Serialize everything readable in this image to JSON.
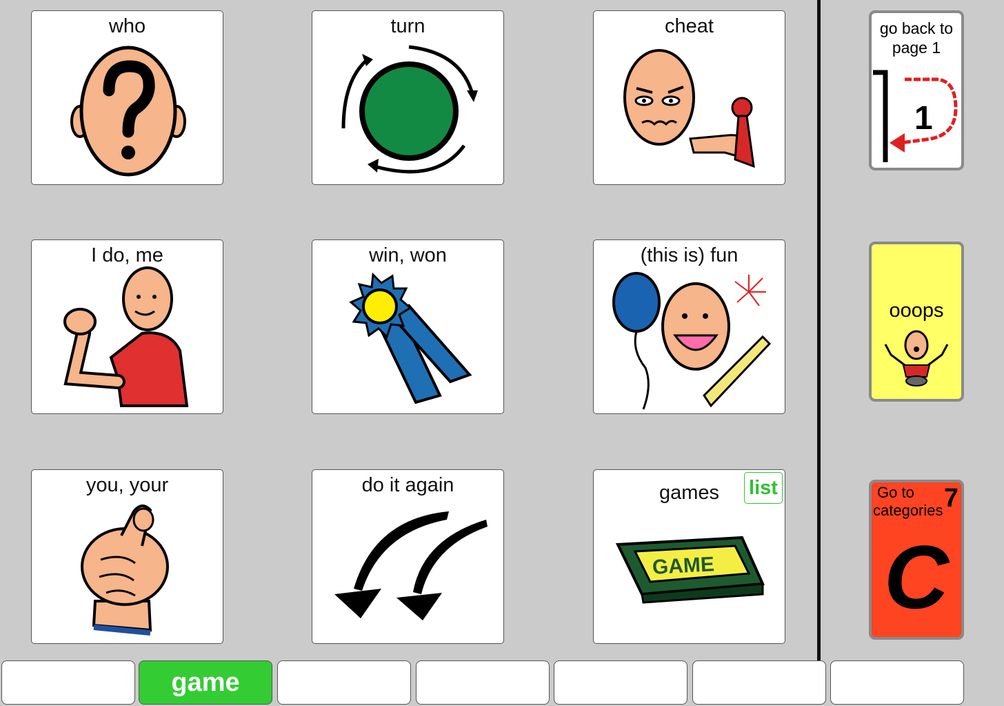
{
  "grid": {
    "tiles": [
      {
        "label": "who",
        "icon": "question-head-icon"
      },
      {
        "label": "turn",
        "icon": "turn-cycle-icon"
      },
      {
        "label": "cheat",
        "icon": "cheat-face-icon"
      },
      {
        "label": "I do, me",
        "icon": "point-self-icon"
      },
      {
        "label": "win,  won",
        "icon": "ribbon-icon"
      },
      {
        "label": "(this is) fun",
        "icon": "party-icon"
      },
      {
        "label": "you, your",
        "icon": "point-you-icon"
      },
      {
        "label": "do it again",
        "icon": "repeat-arrows-icon"
      },
      {
        "label": "games",
        "icon": "game-box-icon",
        "badge": "list"
      }
    ]
  },
  "sidebar": {
    "back": {
      "line1": "go back to",
      "line2": "page 1",
      "number": "1",
      "icon": "back-to-page-icon"
    },
    "oops": {
      "label": "ooops",
      "icon": "oops-person-icon",
      "color": "#ffff66"
    },
    "categories": {
      "line1": "Go to",
      "line2": "categories",
      "number": "7",
      "letter": "C",
      "color": "#ff4422"
    }
  },
  "tabs": [
    {
      "label": ""
    },
    {
      "label": "game",
      "active": true
    },
    {
      "label": ""
    },
    {
      "label": ""
    },
    {
      "label": ""
    },
    {
      "label": ""
    },
    {
      "label": ""
    }
  ],
  "colors": {
    "background": "#cbcbcb",
    "active_tab": "#33cc33",
    "list_badge": "#2ec22e"
  }
}
